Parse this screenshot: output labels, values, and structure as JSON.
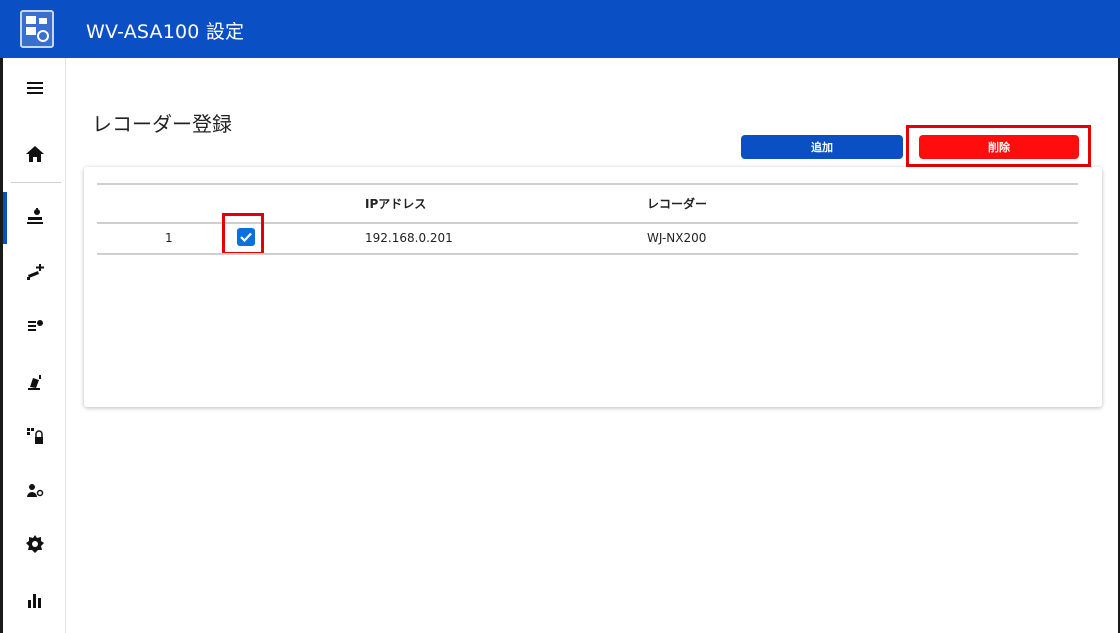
{
  "header": {
    "title": "WV-ASA100 設定",
    "bg_color": "#0a4fc4"
  },
  "sidebar": {
    "items": [
      {
        "name": "menu-icon"
      },
      {
        "name": "home-icon"
      },
      {
        "name": "recorder-icon",
        "active": true
      },
      {
        "name": "add-camera-icon"
      },
      {
        "name": "camera-settings-icon"
      },
      {
        "name": "alarm-icon"
      },
      {
        "name": "license-icon"
      },
      {
        "name": "user-settings-icon"
      },
      {
        "name": "gear-icon"
      },
      {
        "name": "statistics-icon"
      }
    ]
  },
  "page": {
    "title": "レコーダー登録"
  },
  "actions": {
    "add_label": "追加",
    "delete_label": "削除",
    "add_color": "#0a4fc4",
    "delete_color": "#ff0d0d"
  },
  "table": {
    "headers": [
      "",
      "",
      "IPアドレス",
      "レコーダー"
    ],
    "rows": [
      {
        "index": "1",
        "checked": true,
        "ip": "192.168.0.201",
        "recorder": "WJ-NX200"
      }
    ]
  },
  "highlight_color": "#e60000"
}
